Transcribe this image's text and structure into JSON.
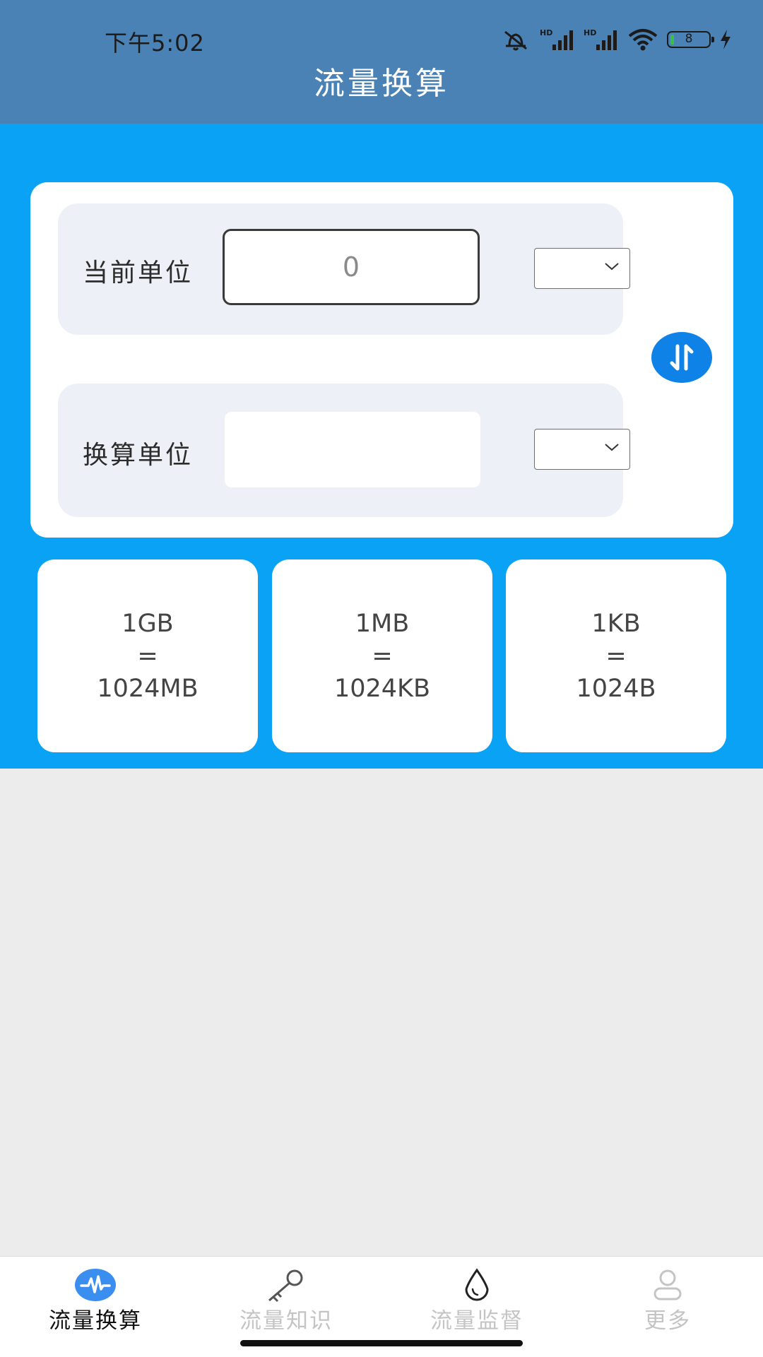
{
  "status_bar": {
    "time": "下午5:02",
    "battery": "8",
    "icons": [
      "bell-muted-icon",
      "hd-signal-icon",
      "hd-signal-icon",
      "wifi-icon",
      "battery-icon",
      "charging-icon"
    ]
  },
  "header": {
    "title": "流量换算"
  },
  "converter": {
    "current_label": "当前单位",
    "current_value": "0",
    "current_unit": "",
    "target_label": "换算单位",
    "target_value": "",
    "target_unit": "",
    "swap_icon": "swap-vertical-icon"
  },
  "info_cards": [
    {
      "top": "1GB",
      "eq": "=",
      "bottom": "1024MB"
    },
    {
      "top": "1MB",
      "eq": "=",
      "bottom": "1024KB"
    },
    {
      "top": "1KB",
      "eq": "=",
      "bottom": "1024B"
    }
  ],
  "nav": {
    "items": [
      {
        "label": "流量换算",
        "icon": "pulse-icon",
        "active": true
      },
      {
        "label": "流量知识",
        "icon": "key-icon",
        "active": false
      },
      {
        "label": "流量监督",
        "icon": "water-drop-icon",
        "active": false
      },
      {
        "label": "更多",
        "icon": "person-icon",
        "active": false
      }
    ]
  },
  "colors": {
    "header_bg": "#4a82b5",
    "accent_blue": "#0aa2f5",
    "button_blue": "#0f82e8",
    "page_bg": "#ececec"
  }
}
